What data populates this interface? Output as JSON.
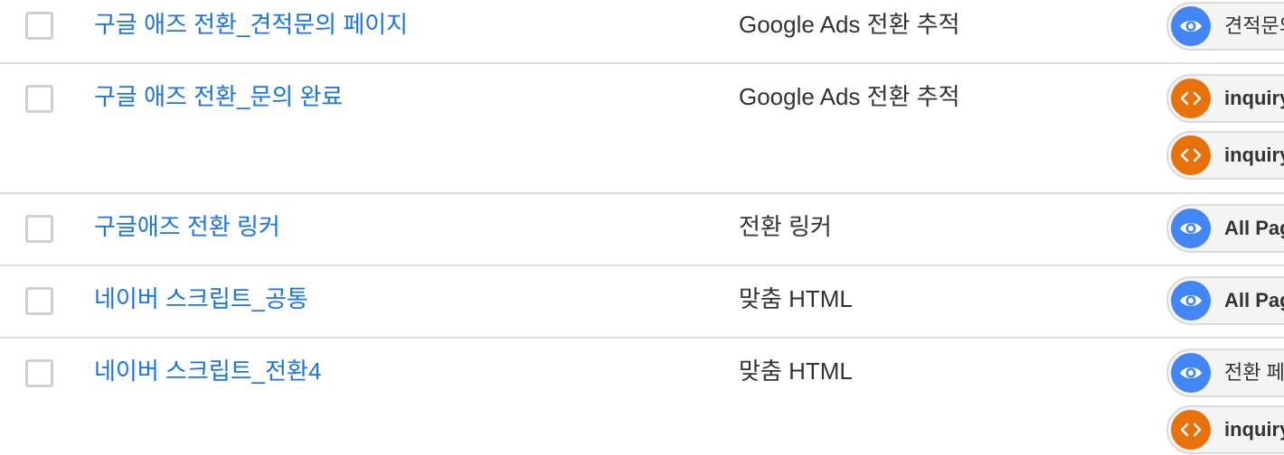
{
  "colors": {
    "link": "#1a73e8",
    "eye_badge": "#4285f4",
    "code_badge": "#e8710a",
    "divider": "#dddddd"
  },
  "rows": [
    {
      "name": "구글 애즈 전환_견적문의 페이지",
      "type": "Google Ads 전환 추적",
      "triggers": [
        {
          "icon": "eye-icon",
          "label": "견적문의"
        }
      ]
    },
    {
      "name": "구글 애즈 전환_문의 완료",
      "type": "Google Ads 전환 추적",
      "triggers": [
        {
          "icon": "code-icon",
          "label": "inquiry"
        },
        {
          "icon": "code-icon",
          "label": "inquiry"
        }
      ]
    },
    {
      "name": "구글애즈 전환 링커",
      "type": "전환 링커",
      "triggers": [
        {
          "icon": "eye-icon",
          "label": "All Pages"
        }
      ]
    },
    {
      "name": "네이버 스크립트_공통",
      "type": "맞춤 HTML",
      "triggers": [
        {
          "icon": "eye-icon",
          "label": "All Pages"
        }
      ]
    },
    {
      "name": "네이버 스크립트_전환4",
      "type": "맞춤 HTML",
      "triggers": [
        {
          "icon": "eye-icon",
          "label": "전환 페이지"
        },
        {
          "icon": "code-icon",
          "label": "inquiry"
        }
      ]
    }
  ]
}
